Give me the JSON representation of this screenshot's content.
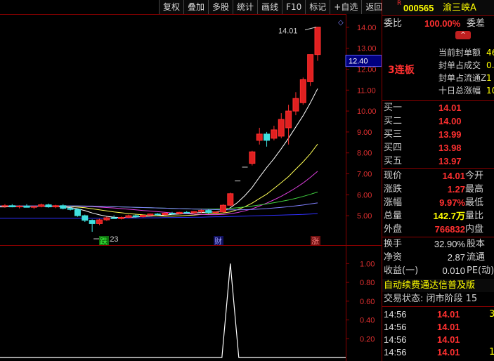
{
  "toolbar": [
    "复权",
    "叠加",
    "多股",
    "统计",
    "画线",
    "F10",
    "标记",
    "+自选",
    "返回"
  ],
  "stock": {
    "badge": "R",
    "code": "000565",
    "name": "渝三峡A"
  },
  "chart_data": {
    "type": "candlestick",
    "price_ticks": [
      "14.00",
      "13.00",
      "12.00",
      "11.00",
      "10.00",
      "9.00",
      "8.00",
      "7.00",
      "6.00",
      "5.00"
    ],
    "price_range": [
      4.5,
      14.4
    ],
    "current_price_tag": "12.40",
    "high_annotation": "14.01",
    "low_annotation": "4.23",
    "markers": [
      "跌",
      "财",
      "涨"
    ],
    "indicator_ticks": [
      "1.00",
      "0.80",
      "0.60",
      "0.40",
      "0.20"
    ],
    "indicator_range": [
      0,
      1.1
    ],
    "candles": [
      {
        "o": 5.45,
        "h": 5.55,
        "l": 5.38,
        "c": 5.48
      },
      {
        "o": 5.48,
        "h": 5.55,
        "l": 5.4,
        "c": 5.42
      },
      {
        "o": 5.42,
        "h": 5.5,
        "l": 5.35,
        "c": 5.46
      },
      {
        "o": 5.46,
        "h": 5.55,
        "l": 5.4,
        "c": 5.4
      },
      {
        "o": 5.4,
        "h": 5.48,
        "l": 5.32,
        "c": 5.44
      },
      {
        "o": 5.44,
        "h": 5.58,
        "l": 5.4,
        "c": 5.52
      },
      {
        "o": 5.52,
        "h": 5.58,
        "l": 5.38,
        "c": 5.42
      },
      {
        "o": 5.42,
        "h": 5.52,
        "l": 5.36,
        "c": 5.48
      },
      {
        "o": 5.48,
        "h": 5.55,
        "l": 5.3,
        "c": 5.35
      },
      {
        "o": 5.35,
        "h": 5.45,
        "l": 5.25,
        "c": 5.3
      },
      {
        "o": 5.3,
        "h": 5.35,
        "l": 4.95,
        "c": 5.0
      },
      {
        "o": 5.0,
        "h": 5.05,
        "l": 4.7,
        "c": 4.78
      },
      {
        "o": 4.78,
        "h": 4.82,
        "l": 4.23,
        "c": 4.62
      },
      {
        "o": 4.62,
        "h": 4.85,
        "l": 4.55,
        "c": 4.8
      },
      {
        "o": 4.8,
        "h": 4.95,
        "l": 4.75,
        "c": 4.9
      },
      {
        "o": 4.9,
        "h": 5.02,
        "l": 4.85,
        "c": 4.86
      },
      {
        "o": 4.86,
        "h": 4.96,
        "l": 4.82,
        "c": 4.92
      },
      {
        "o": 4.92,
        "h": 5.05,
        "l": 4.88,
        "c": 5.0
      },
      {
        "o": 5.0,
        "h": 5.06,
        "l": 4.9,
        "c": 4.95
      },
      {
        "o": 4.95,
        "h": 5.05,
        "l": 4.92,
        "c": 5.02
      },
      {
        "o": 5.02,
        "h": 5.1,
        "l": 4.98,
        "c": 5.08
      },
      {
        "o": 5.08,
        "h": 5.12,
        "l": 5.0,
        "c": 5.05
      },
      {
        "o": 5.05,
        "h": 5.15,
        "l": 5.02,
        "c": 5.12
      },
      {
        "o": 5.12,
        "h": 5.18,
        "l": 5.05,
        "c": 5.1
      },
      {
        "o": 5.1,
        "h": 5.18,
        "l": 5.06,
        "c": 5.16
      },
      {
        "o": 5.16,
        "h": 5.22,
        "l": 5.1,
        "c": 5.14
      },
      {
        "o": 5.14,
        "h": 5.22,
        "l": 5.1,
        "c": 5.2
      },
      {
        "o": 5.2,
        "h": 5.3,
        "l": 5.12,
        "c": 5.25
      },
      {
        "o": 5.25,
        "h": 5.3,
        "l": 5.1,
        "c": 5.15
      },
      {
        "o": 5.15,
        "h": 5.2,
        "l": 5.12,
        "c": 5.18
      },
      {
        "o": 5.18,
        "h": 5.55,
        "l": 5.15,
        "c": 5.5
      },
      {
        "o": 5.5,
        "h": 6.1,
        "l": 5.45,
        "c": 6.05
      },
      {
        "o": 6.66,
        "h": 6.66,
        "l": 6.66,
        "c": 6.66
      },
      {
        "o": 7.32,
        "h": 7.32,
        "l": 7.32,
        "c": 7.32
      },
      {
        "o": 7.5,
        "h": 8.1,
        "l": 7.4,
        "c": 8.05
      },
      {
        "o": 8.6,
        "h": 9.2,
        "l": 8.4,
        "c": 8.9
      },
      {
        "o": 8.9,
        "h": 9.0,
        "l": 8.3,
        "c": 8.6
      },
      {
        "o": 8.7,
        "h": 9.3,
        "l": 8.6,
        "c": 9.1
      },
      {
        "o": 8.8,
        "h": 9.9,
        "l": 8.7,
        "c": 9.6
      },
      {
        "o": 9.2,
        "h": 10.3,
        "l": 8.4,
        "c": 10.0
      },
      {
        "o": 10.0,
        "h": 10.9,
        "l": 9.8,
        "c": 10.6
      },
      {
        "o": 10.4,
        "h": 11.6,
        "l": 10.3,
        "c": 11.5
      },
      {
        "o": 11.4,
        "h": 12.7,
        "l": 11.2,
        "c": 12.7
      },
      {
        "o": 12.7,
        "h": 14.01,
        "l": 12.4,
        "c": 14.01
      }
    ],
    "moving_averages": [
      {
        "color": "#ffffff",
        "values": [
          5.42,
          5.43,
          5.43,
          5.44,
          5.44,
          5.45,
          5.45,
          5.44,
          5.42,
          5.39,
          5.33,
          5.24,
          5.13,
          5.04,
          4.97,
          4.93,
          4.91,
          4.92,
          4.94,
          4.96,
          4.98,
          5.0,
          5.03,
          5.06,
          5.08,
          5.1,
          5.13,
          5.15,
          5.17,
          5.18,
          5.23,
          5.38,
          5.63,
          5.96,
          6.35,
          6.84,
          7.3,
          7.73,
          8.2,
          8.7,
          9.24,
          9.78,
          10.39,
          11.07
        ]
      },
      {
        "color": "#ffff55",
        "values": [
          5.44,
          5.44,
          5.44,
          5.44,
          5.44,
          5.44,
          5.44,
          5.44,
          5.44,
          5.43,
          5.41,
          5.38,
          5.33,
          5.28,
          5.23,
          5.18,
          5.14,
          5.1,
          5.07,
          5.04,
          5.01,
          4.99,
          4.98,
          4.98,
          4.99,
          5.01,
          5.03,
          5.06,
          5.08,
          5.1,
          5.13,
          5.18,
          5.29,
          5.43,
          5.6,
          5.82,
          6.03,
          6.3,
          6.58,
          6.87,
          7.22,
          7.57,
          7.96,
          8.42
        ]
      },
      {
        "color": "#e040e0",
        "values": [
          5.45,
          5.45,
          5.45,
          5.45,
          5.45,
          5.45,
          5.45,
          5.45,
          5.45,
          5.45,
          5.45,
          5.44,
          5.43,
          5.41,
          5.39,
          5.37,
          5.34,
          5.31,
          5.28,
          5.25,
          5.22,
          5.19,
          5.16,
          5.13,
          5.11,
          5.09,
          5.07,
          5.06,
          5.05,
          5.05,
          5.06,
          5.09,
          5.15,
          5.23,
          5.33,
          5.46,
          5.6,
          5.76,
          5.93,
          6.12,
          6.33,
          6.56,
          6.83,
          7.12
        ]
      },
      {
        "color": "#40d040",
        "values": [
          5.46,
          5.46,
          5.46,
          5.46,
          5.46,
          5.46,
          5.46,
          5.46,
          5.46,
          5.46,
          5.46,
          5.46,
          5.45,
          5.45,
          5.44,
          5.43,
          5.42,
          5.41,
          5.4,
          5.39,
          5.38,
          5.37,
          5.36,
          5.35,
          5.34,
          5.33,
          5.32,
          5.32,
          5.32,
          5.32,
          5.33,
          5.35,
          5.38,
          5.42,
          5.46,
          5.51,
          5.56,
          5.62,
          5.68,
          5.75,
          5.83,
          5.92,
          6.02,
          6.13
        ]
      },
      {
        "color": "#8080ff",
        "values": [
          5.47,
          5.47,
          5.47,
          5.47,
          5.47,
          5.47,
          5.47,
          5.47,
          5.47,
          5.47,
          5.47,
          5.46,
          5.46,
          5.45,
          5.44,
          5.43,
          5.42,
          5.41,
          5.4,
          5.39,
          5.38,
          5.37,
          5.36,
          5.35,
          5.34,
          5.33,
          5.32,
          5.31,
          5.3,
          5.29,
          5.28,
          5.28,
          5.28,
          5.29,
          5.3,
          5.32,
          5.34,
          5.37,
          5.4,
          5.43,
          5.47,
          5.51,
          5.56,
          5.61
        ]
      },
      {
        "color": "#3030ff",
        "values": [
          4.88,
          4.88,
          4.88,
          4.88,
          4.88,
          4.88,
          4.88,
          4.88,
          4.88,
          4.88,
          4.88,
          4.88,
          4.88,
          4.88,
          4.88,
          4.89,
          4.89,
          4.89,
          4.89,
          4.9,
          4.9,
          4.9,
          4.91,
          4.91,
          4.92,
          4.92,
          4.93,
          4.93,
          4.94,
          4.95,
          4.95,
          4.96,
          4.97,
          4.98,
          4.99,
          5.0,
          5.01,
          5.02,
          5.03,
          5.04,
          5.05,
          5.06,
          5.08,
          5.1
        ]
      }
    ],
    "indicator_peak": {
      "index": 31,
      "value": 1.0
    }
  },
  "panel": {
    "weibi_label": "委比",
    "weibi_value": "100.00%",
    "weicha_label": "委差",
    "seal_items": [
      {
        "label": "当前封单额",
        "value": "46"
      },
      {
        "label": "封单占成交",
        "value": "0."
      },
      {
        "label": "封单占流通Z",
        "value": "1"
      },
      {
        "label": "十日总涨幅",
        "value": "10"
      }
    ],
    "limit_up_label": "3连板",
    "buy_rows": [
      {
        "label": "买一",
        "price": "14.01"
      },
      {
        "label": "买二",
        "price": "14.00"
      },
      {
        "label": "买三",
        "price": "13.99"
      },
      {
        "label": "买四",
        "price": "13.98"
      },
      {
        "label": "买五",
        "price": "13.97"
      }
    ],
    "quote_rows": [
      {
        "l1": "现价",
        "v1": "14.01",
        "l2": "今开",
        "color": "#ff3030"
      },
      {
        "l1": "涨跌",
        "v1": "1.27",
        "l2": "最高",
        "color": "#ff3030"
      },
      {
        "l1": "涨幅",
        "v1": "9.97%",
        "l2": "最低",
        "color": "#ff3030"
      },
      {
        "l1": "总量",
        "v1": "142.7万",
        "l2": "量比",
        "color": "#ffff00"
      },
      {
        "l1": "外盘",
        "v1": "766832",
        "l2": "内盘",
        "color": "#ff3030"
      }
    ],
    "stat_rows": [
      {
        "l1": "换手",
        "v1": "32.90%",
        "l2": "股本"
      },
      {
        "l1": "净资",
        "v1": "2.87",
        "l2": "流通"
      },
      {
        "l1": "收益(一)",
        "v1": "0.010",
        "l2": "PE(动)"
      }
    ],
    "ad_text": "自动续费通达信普及版",
    "trade_status": "交易状态: 闭市阶段 15",
    "ticks": [
      {
        "time": "14:56",
        "price": "14.01",
        "vol": "3"
      },
      {
        "time": "14:56",
        "price": "14.01",
        "vol": ""
      },
      {
        "time": "14:56",
        "price": "14.01",
        "vol": ""
      },
      {
        "time": "14:56",
        "price": "14.01",
        "vol": "1"
      }
    ]
  }
}
